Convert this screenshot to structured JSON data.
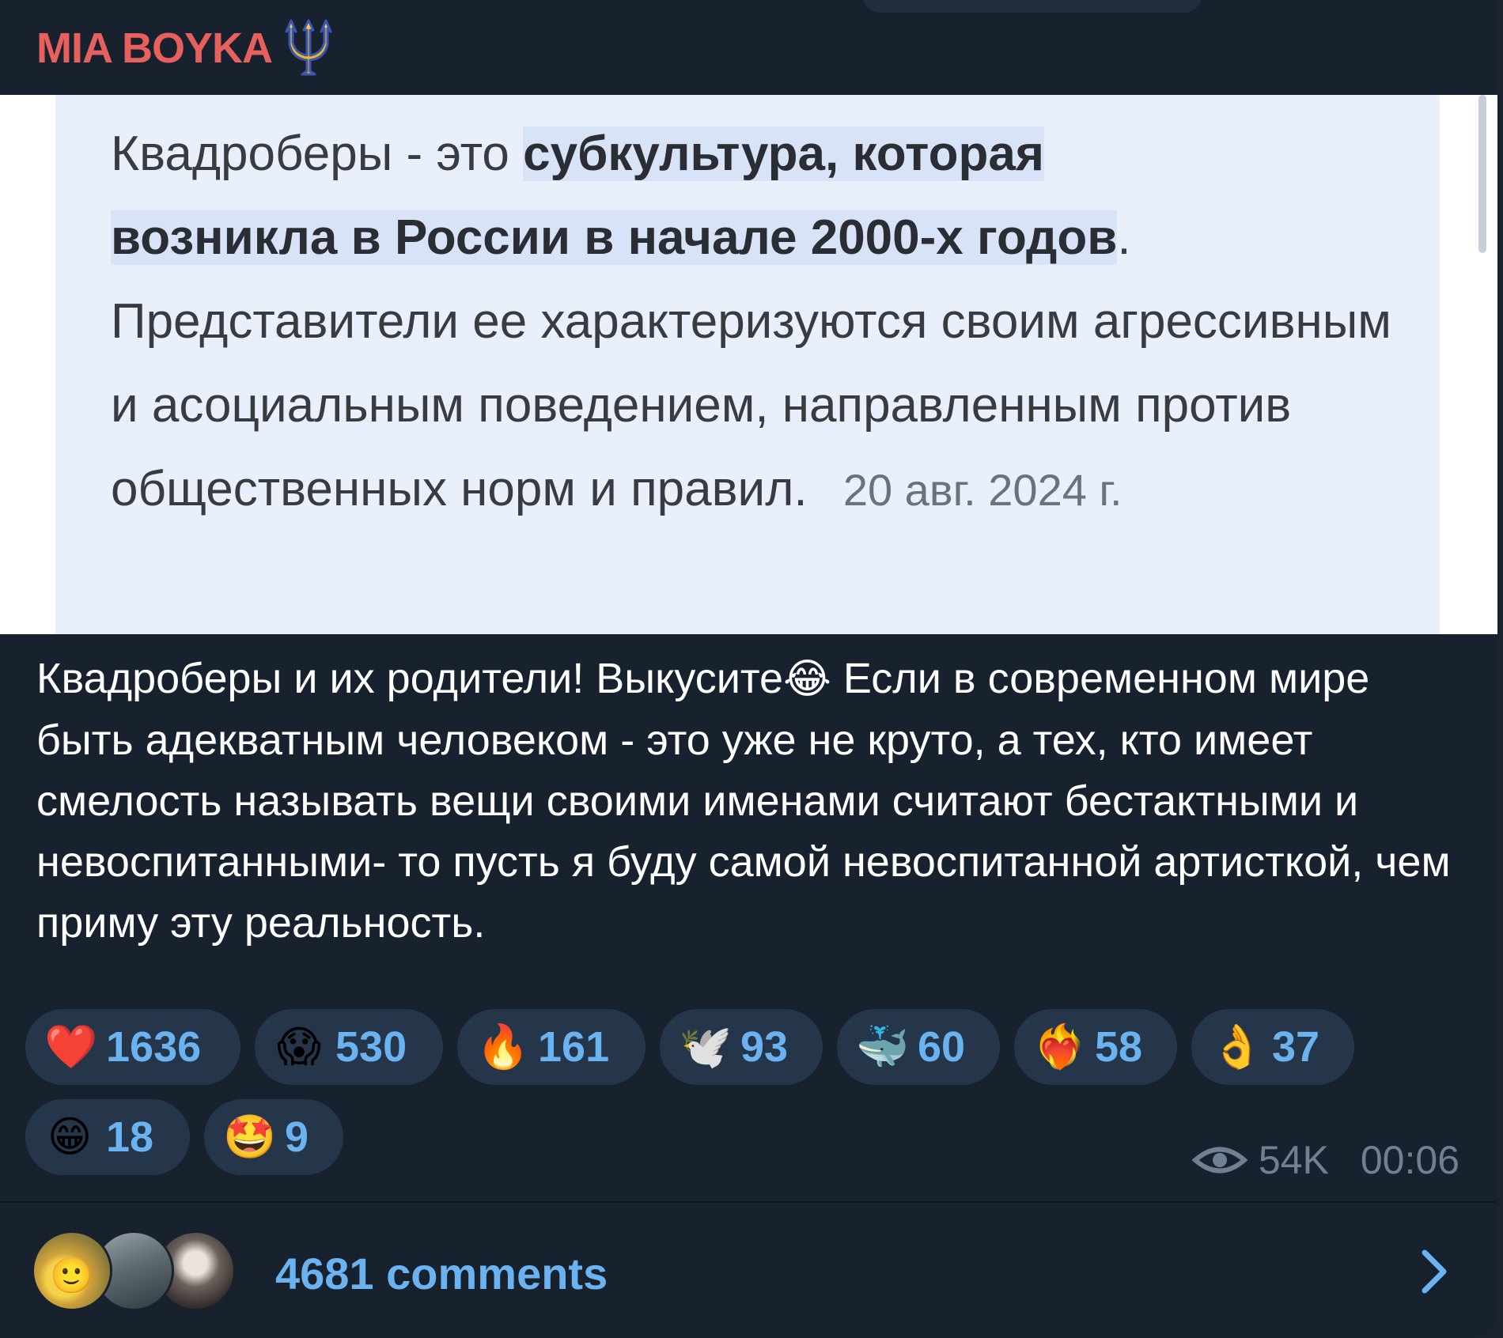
{
  "header": {
    "author": "MIA BOYKA",
    "author_icon": "trident-icon"
  },
  "quote": {
    "highlight1": "субкультура, которая",
    "prefix": "Квадроберы - это ",
    "highlight2": "возникла в России в начале 2000-х годов",
    "highlight2_end": ".",
    "body": "Представители ее характеризуются своим агрессивным и асоциальным поведением, направленным против общественных норм и правил.",
    "date": "20 авг. 2024 г."
  },
  "post": {
    "part1": "Квадроберы и их родители! Выкусите",
    "emoji": "😂",
    "part2": " Если в современном мире быть адекватным человеком - это уже не круто, а тех, кто имеет смелость называть вещи своими именами считают бестактными и невоспитанными- то пусть я буду самой невоспитанной артисткой, чем приму эту реальность."
  },
  "reactions": [
    {
      "emoji": "❤️",
      "count": "1636"
    },
    {
      "emoji": "😱",
      "count": "530"
    },
    {
      "emoji": "🔥",
      "count": "161"
    },
    {
      "emoji": "🕊️",
      "count": "93"
    },
    {
      "emoji": "🐳",
      "count": "60"
    },
    {
      "emoji": "❤️‍🔥",
      "count": "58"
    },
    {
      "emoji": "👌",
      "count": "37"
    },
    {
      "emoji": "😁",
      "count": "18"
    },
    {
      "emoji": "🤩",
      "count": "9"
    }
  ],
  "meta": {
    "views": "54K",
    "time": "00:06"
  },
  "comments": {
    "label": "4681 comments"
  },
  "colors": {
    "accent": "#6ab2f0",
    "author": "#e8605e",
    "bubble": "#18222f",
    "pill": "#26364a"
  }
}
